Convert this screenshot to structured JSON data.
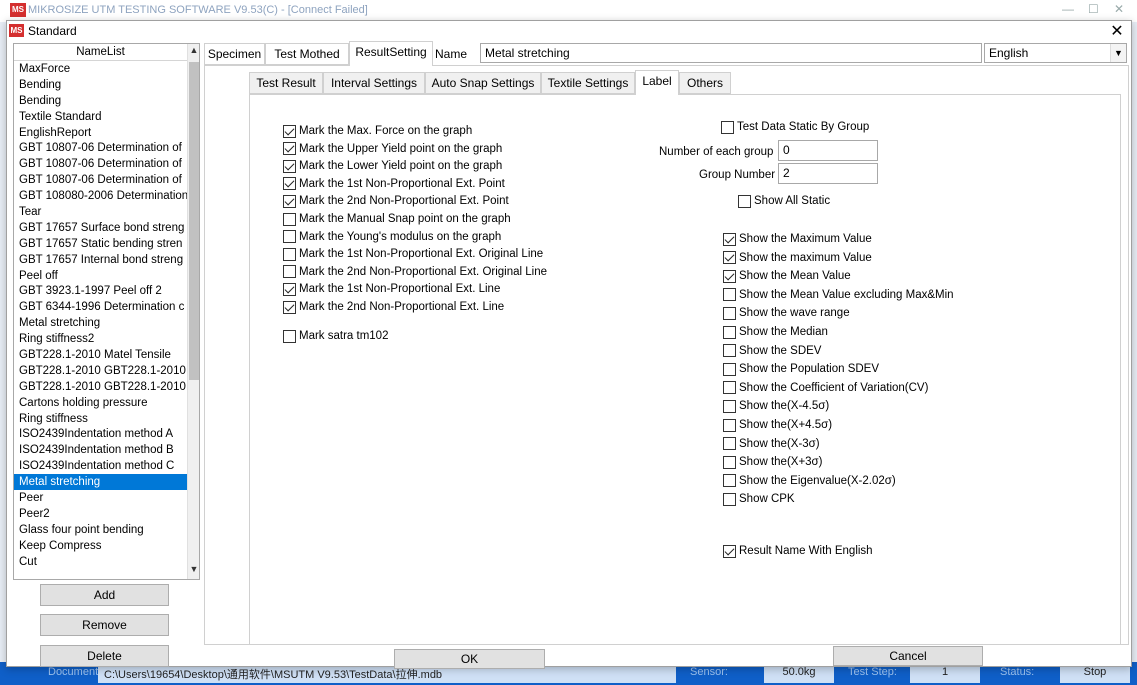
{
  "background": {
    "title": "MIKROSIZE UTM TESTING SOFTWARE V9.53(C) - [Connect Failed]",
    "status": {
      "document_label": "Document:",
      "document_path": "C:\\Users\\19654\\Desktop\\通用软件\\MSUTM V9.53\\TestData\\拉伸.mdb",
      "sensor_label": "Sensor:",
      "sensor_value": "50.0kg",
      "teststep_label": "Test Step:",
      "teststep_value": "1",
      "status_label": "Status:",
      "status_value": "Stop"
    }
  },
  "dialog": {
    "title": "Standard",
    "logo": "MS"
  },
  "namelist": {
    "header": "NameList",
    "items": [
      "MaxForce",
      "Bending",
      "Bending",
      "Textile Standard",
      "EnglishReport",
      "GBT 10807-06 Determination of",
      "GBT 10807-06 Determination of",
      "GBT 10807-06 Determination of",
      "GBT 108080-2006 Determination",
      "Tear",
      "GBT 17657 Surface bond streng",
      "GBT 17657 Static bending stren",
      "GBT 17657 Internal bond streng",
      "Peel off",
      "GBT 3923.1-1997 Peel off 2",
      "GBT 6344-1996 Determination c",
      "Metal stretching",
      "Ring stiffness2",
      "GBT228.1-2010 Matel Tensile",
      "GBT228.1-2010 GBT228.1-2010",
      "GBT228.1-2010 GBT228.1-2010",
      "Cartons holding pressure",
      "Ring stiffness",
      "ISO2439Indentation method A",
      "ISO2439Indentation method B",
      "ISO2439Indentation method C",
      "Metal stretching",
      "Peer",
      "Peer2",
      "Glass four point bending",
      "Keep Compress",
      "Cut"
    ],
    "selected_index": 26
  },
  "buttons": {
    "add": "Add",
    "remove": "Remove",
    "delete": "Delete",
    "ok": "OK",
    "cancel": "Cancel"
  },
  "top_tabs": [
    "Specimen",
    "Test Mothed",
    "ResultSetting"
  ],
  "name_label": "Name",
  "name_value": "Metal stretching",
  "language": "English",
  "sub_tabs": [
    "Test Result",
    "Interval Settings",
    "Auto Snap Settings",
    "Textile Settings",
    "Label",
    "Others"
  ],
  "left_checks": [
    {
      "label": "Mark the Max. Force on the graph",
      "checked": true
    },
    {
      "label": "Mark the Upper Yield point on the graph",
      "checked": true
    },
    {
      "label": "Mark the Lower Yield point on the graph",
      "checked": true
    },
    {
      "label": "Mark the 1st Non-Proportional Ext. Point",
      "checked": true
    },
    {
      "label": "Mark the 2nd Non-Proportional Ext. Point",
      "checked": true
    },
    {
      "label": "Mark the Manual Snap point on the graph",
      "checked": false
    },
    {
      "label": "Mark the Young's modulus on the graph",
      "checked": false
    },
    {
      "label": "Mark the 1st Non-Proportional Ext. Original Line",
      "checked": false
    },
    {
      "label": "Mark the 2nd Non-Proportional Ext. Original Line",
      "checked": false
    },
    {
      "label": "Mark the 1st Non-Proportional Ext. Line",
      "checked": true
    },
    {
      "label": "Mark the 2nd Non-Proportional Ext. Line",
      "checked": true
    }
  ],
  "mark_satra": {
    "label": "Mark satra tm102",
    "checked": false
  },
  "group": {
    "static_by_group": {
      "label": "Test Data Static By Group",
      "checked": false
    },
    "number_each_label": "Number of each group",
    "number_each_value": "0",
    "group_number_label": "Group Number",
    "group_number_value": "2",
    "show_all": {
      "label": "Show All Static",
      "checked": false
    }
  },
  "right_checks": [
    {
      "label": "Show the Maximum Value",
      "checked": true
    },
    {
      "label": "Show the maximum Value",
      "checked": true
    },
    {
      "label": "Show the Mean Value",
      "checked": true
    },
    {
      "label": "Show the Mean Value excluding Max&Min",
      "checked": false
    },
    {
      "label": "Show the wave range",
      "checked": false
    },
    {
      "label": "Show the Median",
      "checked": false
    },
    {
      "label": "Show the SDEV",
      "checked": false
    },
    {
      "label": "Show the Population SDEV",
      "checked": false
    },
    {
      "label": "Show the Coefficient of Variation(CV)",
      "checked": false
    },
    {
      "label": "Show the(X-4.5σ)",
      "checked": false
    },
    {
      "label": "Show the(X+4.5σ)",
      "checked": false
    },
    {
      "label": "Show the(X-3σ)",
      "checked": false
    },
    {
      "label": "Show the(X+3σ)",
      "checked": false
    },
    {
      "label": "Show the Eigenvalue(X-2.02σ)",
      "checked": false
    },
    {
      "label": "Show CPK",
      "checked": false
    }
  ],
  "result_english": {
    "label": "Result Name With English",
    "checked": true
  }
}
